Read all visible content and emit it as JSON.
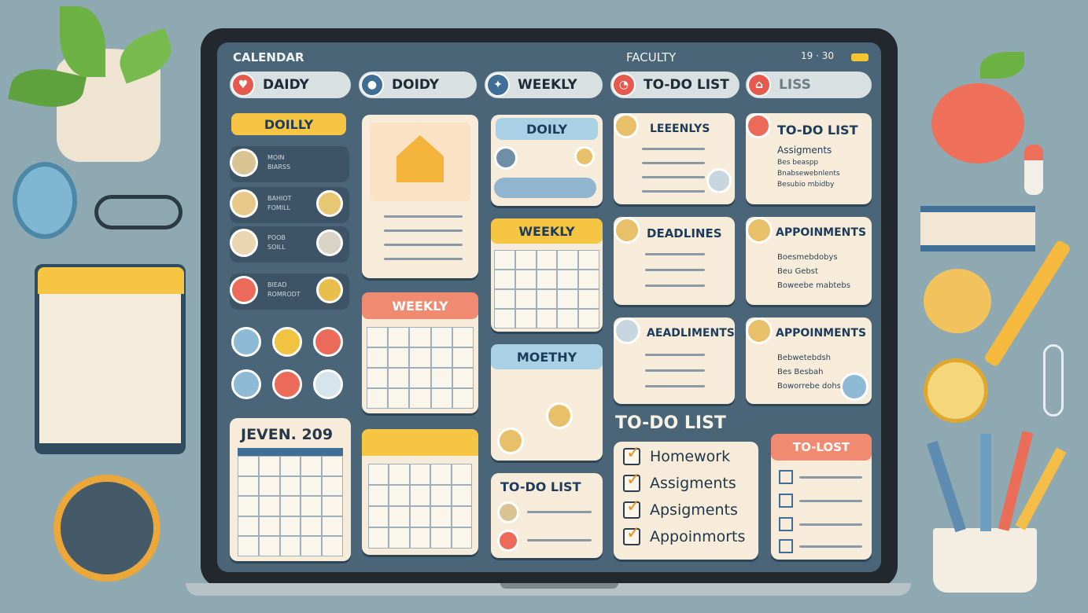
{
  "topbar": {
    "title": "CALENDAR",
    "center": "FACULTY",
    "right": "19 · 30"
  },
  "tabs": [
    {
      "label": "DAIDY",
      "color": "#e65a4e"
    },
    {
      "label": "DOIDY",
      "color": "#3f6f97"
    },
    {
      "label": "WEEKLY",
      "color": "#3f6f97"
    },
    {
      "label": "TO-DO LIST",
      "color": "#e65a4e"
    },
    {
      "label": "LISS",
      "color": "#e65a4e"
    }
  ],
  "sidebar": {
    "header": "DOILLY",
    "items": [
      {
        "line1": "MOIN",
        "line2": "BIARSS"
      },
      {
        "line1": "BAHIOT",
        "line2": "FOMILL"
      },
      {
        "line1": "POOB",
        "line2": "SOILL"
      },
      {
        "line1": "BIEAD",
        "line2": "ROMRODT"
      }
    ]
  },
  "mini_calendar": {
    "title": "JEVEN. 209"
  },
  "cards": {
    "doily": "DOILY",
    "weekly1": "WEEKLY",
    "weekly2": "WEEKLY",
    "moethy": "MOETHY",
    "todo_small": "TO-DO LIST",
    "leeenlys": "LEEENLYS",
    "todo_top": "TO-DO LIST",
    "deadlines": "DEADLINES",
    "appoinments": "APPOINMENTS",
    "aeadliments": "AEADLIMENTS",
    "appoinments2": "APPOINMENTS",
    "todo_lost": "TO-LOST"
  },
  "todo_top_items": [
    "Assigments",
    "Bes beaspp",
    "Bnabsewebnlents",
    "Besubio mbidby"
  ],
  "appoinments_items": [
    "Boesmebdobys",
    "Beu Gebst",
    "Boweebe mabtebs"
  ],
  "appoinments2_items": [
    "Bebwetebdsh",
    "Bes Besbah",
    "Boworrebe dohs"
  ],
  "todo_list": {
    "title": "TO-DO LIST",
    "items": [
      "Homework",
      "Assigments",
      "Apsigments",
      "Appoinmorts"
    ]
  },
  "colors": {
    "accent_yellow": "#f6c543",
    "accent_pink": "#f08b72",
    "screen": "#4a6577"
  }
}
